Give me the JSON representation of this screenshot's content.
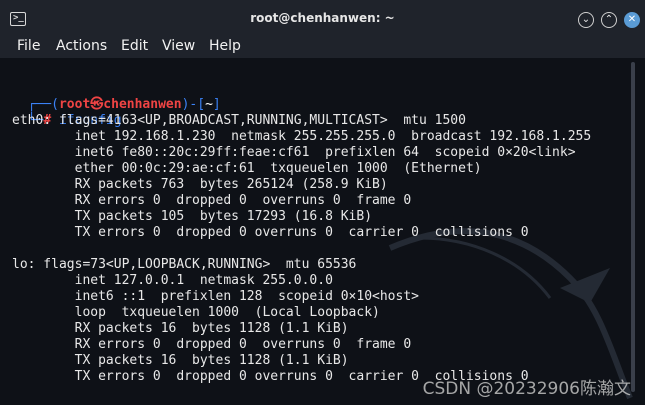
{
  "window": {
    "title": "root@chenhanwen: ~",
    "app_icon": ">_",
    "buttons": [
      "⌄",
      "⌃",
      "✕"
    ]
  },
  "menu": [
    "File",
    "Actions",
    "Edit",
    "View",
    "Help"
  ],
  "prompt": {
    "top_left": "┌──(",
    "user": "root",
    "skull": "㉿",
    "host": "chenhanwen",
    "mid": ")-[",
    "dir": "~",
    "end": "]",
    "bottom_left": "└─",
    "hash": "#",
    "command": "ifconfig"
  },
  "output": [
    "eth0: flags=4163<UP,BROADCAST,RUNNING,MULTICAST>  mtu 1500",
    "        inet 192.168.1.230  netmask 255.255.255.0  broadcast 192.168.1.255",
    "        inet6 fe80::20c:29ff:feae:cf61  prefixlen 64  scopeid 0×20<link>",
    "        ether 00:0c:29:ae:cf:61  txqueuelen 1000  (Ethernet)",
    "        RX packets 763  bytes 265124 (258.9 KiB)",
    "        RX errors 0  dropped 0  overruns 0  frame 0",
    "        TX packets 105  bytes 17293 (16.8 KiB)",
    "        TX errors 0  dropped 0 overruns 0  carrier 0  collisions 0",
    "",
    "lo: flags=73<UP,LOOPBACK,RUNNING>  mtu 65536",
    "        inet 127.0.0.1  netmask 255.0.0.0",
    "        inet6 ::1  prefixlen 128  scopeid 0×10<host>",
    "        loop  txqueuelen 1000  (Local Loopback)",
    "        RX packets 16  bytes 1128 (1.1 KiB)",
    "        RX errors 0  dropped 0  overruns 0  frame 0",
    "        TX packets 16  bytes 1128 (1.1 KiB)",
    "        TX errors 0  dropped 0 overruns 0  carrier 0  collisions 0"
  ],
  "watermark": "CSDN @20232906陈瀚文"
}
